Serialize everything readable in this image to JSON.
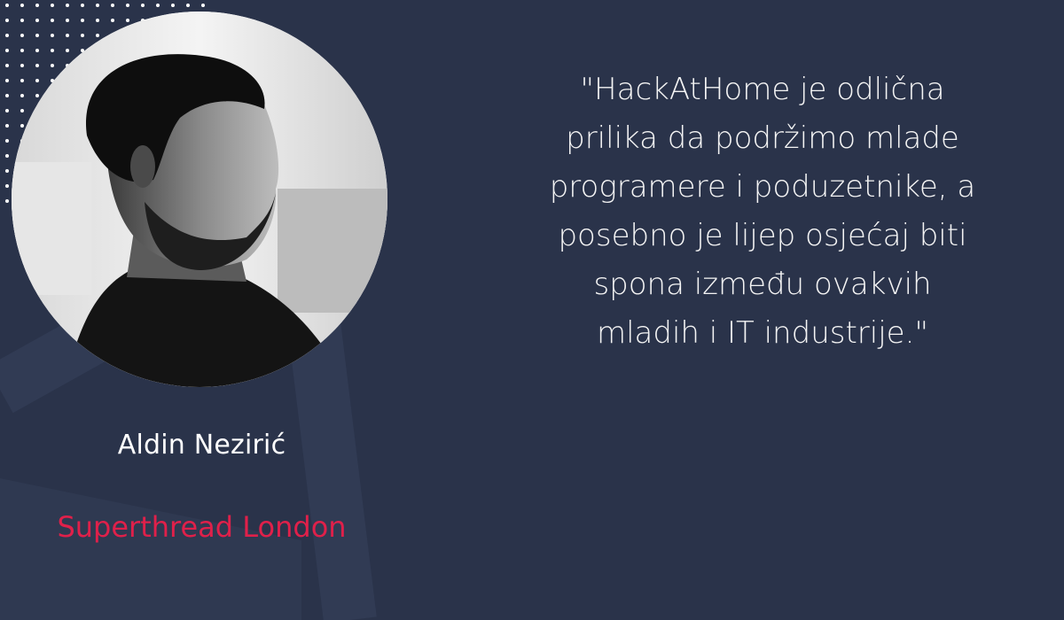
{
  "testimonial": {
    "quote": "\"HackAtHome je odlična\nprilika da podržimo mlade\nprogramere i poduzetnike, a\nposebno je lijep osjećaj biti\nspona između ovakvih\nmladih i IT industrije.\"",
    "name": "Aldin Nezirić",
    "company": "Superthread London"
  },
  "colors": {
    "background": "#2a334a",
    "accent": "#e0204a",
    "text": "#ffffff",
    "decorative_shapes": "#313b54"
  },
  "icons": [
    "dot-grid-pattern",
    "triangle-decoration"
  ]
}
